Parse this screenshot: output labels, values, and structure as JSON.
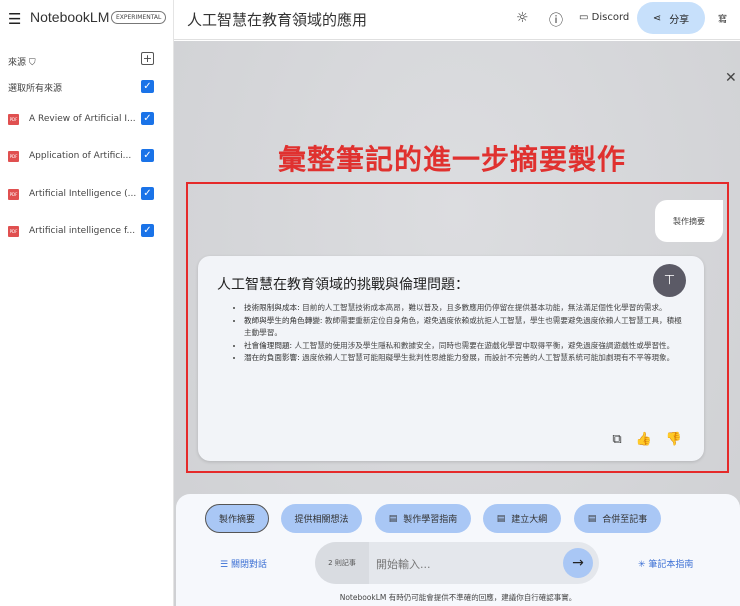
{
  "app": {
    "name": "NotebookLM",
    "badge": "EXPERIMENTAL",
    "menu_icon": "☰"
  },
  "sidebar": {
    "sources_label": "來源",
    "select_all": "選取所有來源",
    "sources": [
      {
        "title": "A Review of Artificial I..."
      },
      {
        "title": "Application of Artifici..."
      },
      {
        "title": "Artificial Intelligence (..."
      },
      {
        "title": "Artificial intelligence f..."
      }
    ]
  },
  "header": {
    "title": "人工智慧在教育領域的應用",
    "discord": "Discord",
    "share": "分享",
    "avatar": "寫"
  },
  "overlay": {
    "annotation": "彙整筆記的進一步摘要製作"
  },
  "chat": {
    "user_message": "製作摘要",
    "response": {
      "title": "人工智慧在教育領域的挑戰與倫理問題：",
      "items": [
        {
          "head": "技術限制與成本:",
          "text": " 目前的人工智慧技術成本高昂，難以普及，且多數應用仍停留在提供基本功能，無法滿足個性化學習的需求。"
        },
        {
          "head": "教師與學生的角色轉變:",
          "text": " 教師需要重新定位自身角色，避免過度依賴或抗拒人工智慧，學生也需要避免過度依賴人工智慧工具，積極主動學習。"
        },
        {
          "head": "社會倫理問題:",
          "text": " 人工智慧的使用涉及學生隱私和數據安全，同時也需要在遊戲化學習中取得平衡，避免過度強調遊戲性或學習性。"
        },
        {
          "head": "潛在的負面影響:",
          "text": " 過度依賴人工智慧可能阻礙學生批判性思維能力發展，而設計不完善的人工智慧系統可能加劇現有不平等現象。"
        }
      ]
    }
  },
  "bottom": {
    "chips": [
      "製作摘要",
      "提供相關想法",
      "製作學習指南",
      "建立大綱",
      "合併至記事"
    ],
    "close_chat": "關閉對話",
    "notes_count": "2 則記事",
    "placeholder": "開始輸入...",
    "guide": "筆記本指南",
    "disclaimer": "NotebookLM 有時仍可能會提供不準確的回應，建議你自行確認事實。"
  },
  "colors": {
    "accent": "#1a73e8",
    "chip": "#a9c7f5",
    "annotation": "#e0312f"
  }
}
